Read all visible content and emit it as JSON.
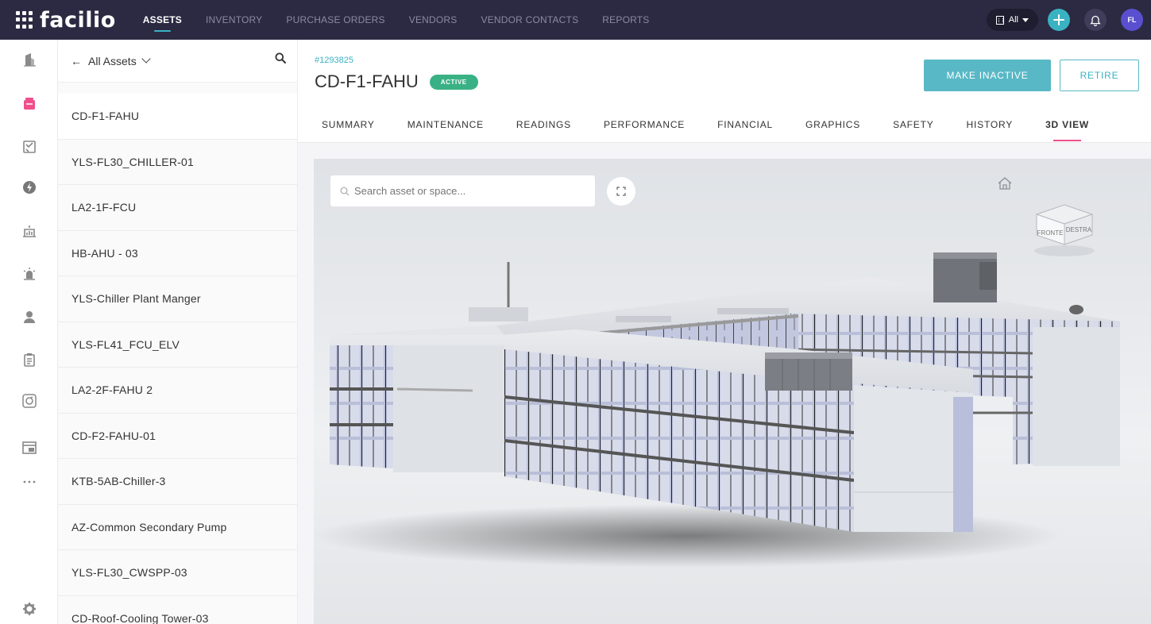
{
  "app": {
    "brand": "facilio",
    "nav": [
      "ASSETS",
      "INVENTORY",
      "PURCHASE ORDERS",
      "VENDORS",
      "VENDOR CONTACTS",
      "REPORTS"
    ],
    "active_nav": "ASSETS",
    "site_select": "All",
    "user_initials": "FL",
    "accent_color": "#3ab2c2",
    "topbar_color": "#2b2a42"
  },
  "rail": {
    "icons": [
      "building-icon",
      "inbox-icon",
      "workorder-icon",
      "energy-icon",
      "dashboard-icon",
      "alarm-icon",
      "people-icon",
      "clipboard-icon",
      "asset-cycle-icon",
      "layout-icon",
      "more-icon"
    ],
    "settings_icon": "gear-icon"
  },
  "asset_list": {
    "header": "All Assets",
    "items": [
      "CD-F1-FAHU",
      "YLS-FL30_CHILLER-01",
      "LA2-1F-FCU",
      "HB-AHU - 03",
      "YLS-Chiller Plant Manger",
      "YLS-FL41_FCU_ELV",
      "LA2-2F-FAHU 2",
      "CD-F2-FAHU-01",
      "KTB-5AB-Chiller-3",
      "AZ-Common Secondary Pump",
      "YLS-FL30_CWSPP-03",
      "CD-Roof-Cooling Tower-03"
    ],
    "selected_index": 0
  },
  "record": {
    "id": "#1293825",
    "title": "CD-F1-FAHU",
    "status": "ACTIVE",
    "status_color": "#39b184",
    "primary_action": "MAKE INACTIVE",
    "secondary_action": "RETIRE"
  },
  "tabs": [
    "SUMMARY",
    "MAINTENANCE",
    "READINGS",
    "PERFORMANCE",
    "FINANCIAL",
    "GRAPHICS",
    "SAFETY",
    "HISTORY",
    "3D VIEW"
  ],
  "active_tab": "3D VIEW",
  "viewer": {
    "search_placeholder": "Search asset or space...",
    "viewcube_front": "FRONTE",
    "viewcube_right": "DESTRA"
  }
}
